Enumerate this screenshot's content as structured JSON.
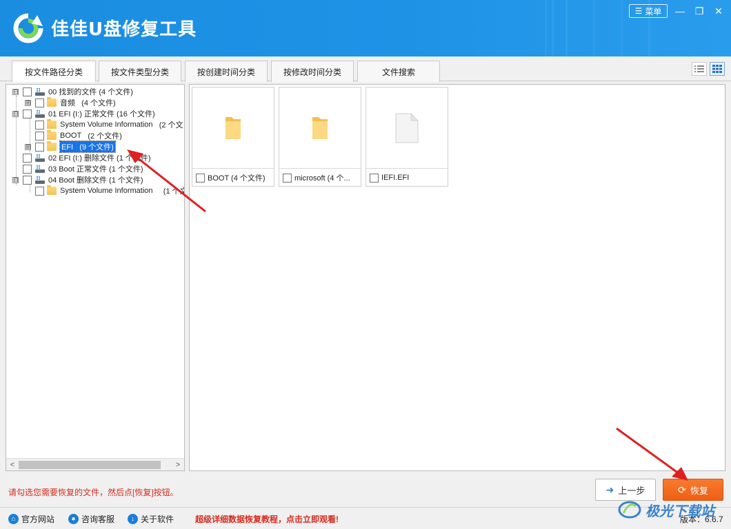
{
  "app": {
    "title": "佳佳U盘修复工具",
    "menu_label": "菜单",
    "brand_color": "#1e93e6"
  },
  "tabs": [
    {
      "label": "按文件路径分类",
      "active": true
    },
    {
      "label": "按文件类型分类",
      "active": false
    },
    {
      "label": "按创建时间分类",
      "active": false
    },
    {
      "label": "按修改时间分类",
      "active": false
    },
    {
      "label": "文件搜索",
      "active": false
    }
  ],
  "view_modes": {
    "list_icon": "list-view-icon",
    "grid_icon": "grid-view-icon",
    "active": "grid"
  },
  "tree": [
    {
      "name": "00 找到的文件",
      "count": "(4 个文件)",
      "icon": "drive-icon",
      "expander": "⊟",
      "level": 0
    },
    {
      "name": "音频",
      "count": "(4 个文件)",
      "icon": "folder-icon",
      "expander": "⊞",
      "level": 1
    },
    {
      "name": "01 EFI (I:) 正常文件",
      "count": "(16 个文件)",
      "icon": "drive-icon",
      "expander": "⊟",
      "level": 0
    },
    {
      "name": "System Volume Information",
      "count": "(2 个文",
      "icon": "folder-icon",
      "expander": "",
      "level": 1
    },
    {
      "name": "BOOT",
      "count": "(2 个文件)",
      "icon": "folder-icon",
      "expander": "",
      "level": 1
    },
    {
      "name": "EFI",
      "count": "(9 个文件)",
      "icon": "folder-icon",
      "expander": "⊞",
      "level": 1,
      "selected": true
    },
    {
      "name": "02 EFI (I:) 删除文件",
      "count": "(1 个文件)",
      "icon": "drive-icon",
      "expander": "",
      "level": 0
    },
    {
      "name": "03 Boot 正常文件",
      "count": "(1 个文件)",
      "icon": "drive-icon",
      "expander": "",
      "level": 0
    },
    {
      "name": "04 Boot 删除文件",
      "count": "(1 个文件)",
      "icon": "drive-icon",
      "expander": "⊟",
      "level": 0
    },
    {
      "name": "System Volume Information",
      "count": "(1 个文",
      "icon": "folder-icon",
      "expander": "",
      "level": 1
    }
  ],
  "files": [
    {
      "label": "BOOT  (4 个文件)",
      "type": "folder"
    },
    {
      "label": "microsoft  (4 个...",
      "type": "folder"
    },
    {
      "label": "IEFI.EFI",
      "type": "file"
    }
  ],
  "hint": "请勾选您需要恢复的文件，然后点[恢复]按钮。",
  "buttons": {
    "prev": "上一步",
    "recover": "恢复"
  },
  "status": {
    "links": [
      "官方网站",
      "咨询客服",
      "关于软件"
    ],
    "promo": "超级详细数据恢复教程，点击立即观看!",
    "version": "版本：6.6.7"
  },
  "watermark": "极光下载站"
}
